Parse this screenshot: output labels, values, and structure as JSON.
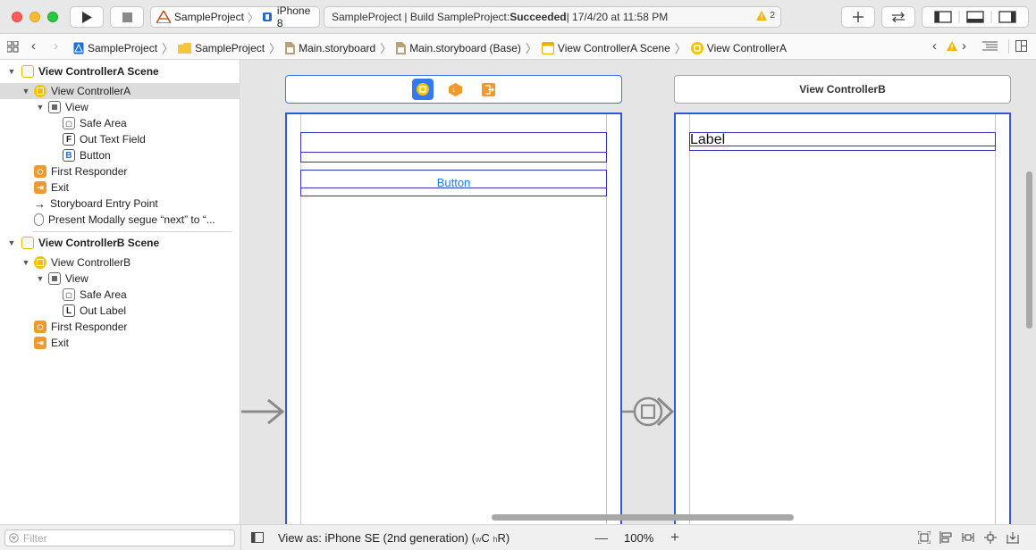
{
  "toolbar": {
    "scheme_project": "SampleProject",
    "scheme_device": "iPhone 8",
    "status_prefix": "SampleProject | Build SampleProject: ",
    "status_result": "Succeeded",
    "status_suffix": " | 17/4/20 at 11:58 PM",
    "warning_count": "2"
  },
  "jumpbar": {
    "crumbs": [
      "SampleProject",
      "SampleProject",
      "Main.storyboard",
      "Main.storyboard (Base)",
      "View ControllerA Scene",
      "View ControllerA"
    ]
  },
  "navigator": {
    "scene_a": {
      "title": "View ControllerA Scene",
      "controller": "View ControllerA",
      "view": "View",
      "safe_area": "Safe Area",
      "text_field": "Out Text Field",
      "button": "Button",
      "first_responder": "First Responder",
      "exit": "Exit",
      "entry_point": "Storyboard Entry Point",
      "segue": "Present Modally segue “next” to “..."
    },
    "scene_b": {
      "title": "View ControllerB Scene",
      "controller": "View ControllerB",
      "view": "View",
      "safe_area": "Safe Area",
      "label": "Out Label",
      "first_responder": "First Responder",
      "exit": "Exit"
    },
    "filter_placeholder": "Filter"
  },
  "canvas": {
    "scene_b_title": "View ControllerB",
    "button_text": "Button",
    "label_text": "Label"
  },
  "bottombar": {
    "view_as": "View as: iPhone SE (2nd generation)",
    "size_w": "w",
    "size_wval": "C",
    "size_h": "h",
    "size_hval": "R",
    "zoom": "100%"
  },
  "colors": {
    "accent": "#3478f6",
    "frame": "#3457d6",
    "storyboard_yellow": "#f5c400",
    "responder_orange": "#f09a2e"
  }
}
